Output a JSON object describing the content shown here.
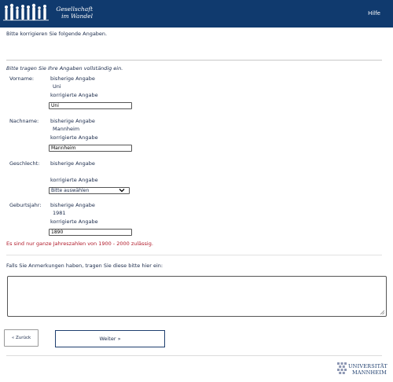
{
  "header": {
    "logo_line1": "Gesellschaft",
    "logo_line2": "im Wandel",
    "help_label": "Hilfe"
  },
  "intro": "Bitte korrigieren Sie folgende Angaben.",
  "required_note": "Bitte tragen Sie Ihre Angaben vollständig ein.",
  "fields": {
    "vorname": {
      "label": "Vorname:",
      "previous_caption": "bisherige Angabe",
      "previous_value": "Uni",
      "corrected_caption": "korrigierte Angabe",
      "value": "Uni"
    },
    "nachname": {
      "label": "Nachname:",
      "previous_caption": "bisherige Angabe",
      "previous_value": "Mannheim",
      "corrected_caption": "korrigierte Angabe",
      "value": "Mannheim"
    },
    "geschlecht": {
      "label": "Geschlecht:",
      "previous_caption": "bisherige Angabe",
      "previous_value": "",
      "corrected_caption": "korrigierte Angabe",
      "selected": "Bitte auswählen"
    },
    "geburtsjahr": {
      "label": "Geburtsjahr:",
      "previous_caption": "bisherige Angabe",
      "previous_value": "1981",
      "corrected_caption": "korrigierte Angabe",
      "value": "1890"
    }
  },
  "error_message": "Es sind nur ganze Jahreszahlen von 1900 - 2000 zulässig.",
  "comment_label": "Falls Sie Anmerkungen haben, tragen Sie diese bitte hier ein:",
  "buttons": {
    "back": "« Zurück",
    "next": "Weiter »"
  },
  "footer": {
    "uni_line1": "UNIVERSITÄT",
    "uni_line2": "MANNHEIM"
  },
  "colors": {
    "header_bg": "#103a6e",
    "error": "#b01828",
    "text": "#1a2a4a"
  }
}
